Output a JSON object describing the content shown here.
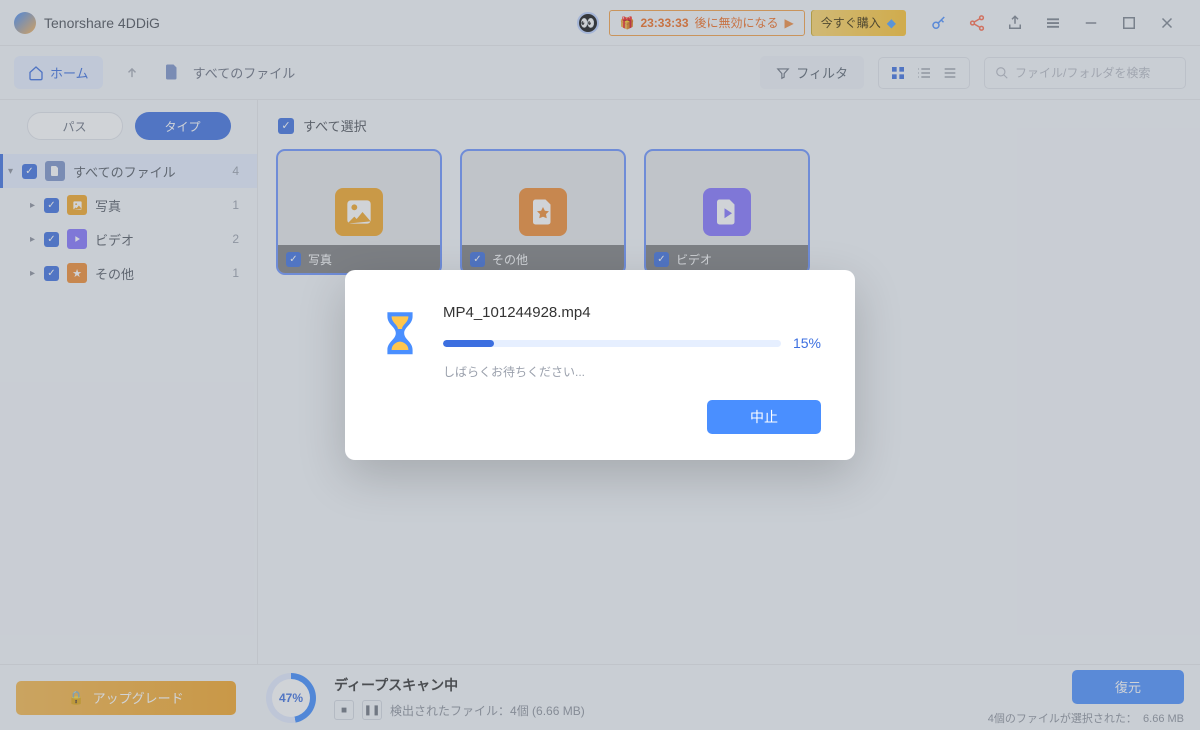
{
  "app": {
    "title": "Tenorshare 4DDiG"
  },
  "titlebar": {
    "timer": "23:33:33",
    "timer_suffix": "後に無効になる",
    "buy_now": "今すぐ購入"
  },
  "toolbar": {
    "home": "ホーム",
    "breadcrumb": "すべてのファイル",
    "filter": "フィルタ",
    "search_placeholder": "ファイル/フォルダを検索"
  },
  "sidebar": {
    "tab_path": "パス",
    "tab_type": "タイプ",
    "items": [
      {
        "label": "すべてのファイル",
        "count": "4"
      },
      {
        "label": "写真",
        "count": "1"
      },
      {
        "label": "ビデオ",
        "count": "2"
      },
      {
        "label": "その他",
        "count": "1"
      }
    ]
  },
  "content": {
    "select_all": "すべて選択",
    "tiles": [
      {
        "label": "写真"
      },
      {
        "label": "その他"
      },
      {
        "label": "ビデオ"
      }
    ]
  },
  "footer": {
    "upgrade": "アップグレード",
    "scan_percent": "47%",
    "scan_title": "ディープスキャン中",
    "scan_detail_label": "検出されたファイル：",
    "scan_detail_value": "4個 (6.66 MB)",
    "recover": "復元",
    "selected_label": "4個のファイルが選択された：",
    "selected_size": "6.66 MB"
  },
  "modal": {
    "filename": "MP4_101244928.mp4",
    "percent": "15%",
    "wait": "しばらくお待ちください...",
    "stop": "中止"
  }
}
